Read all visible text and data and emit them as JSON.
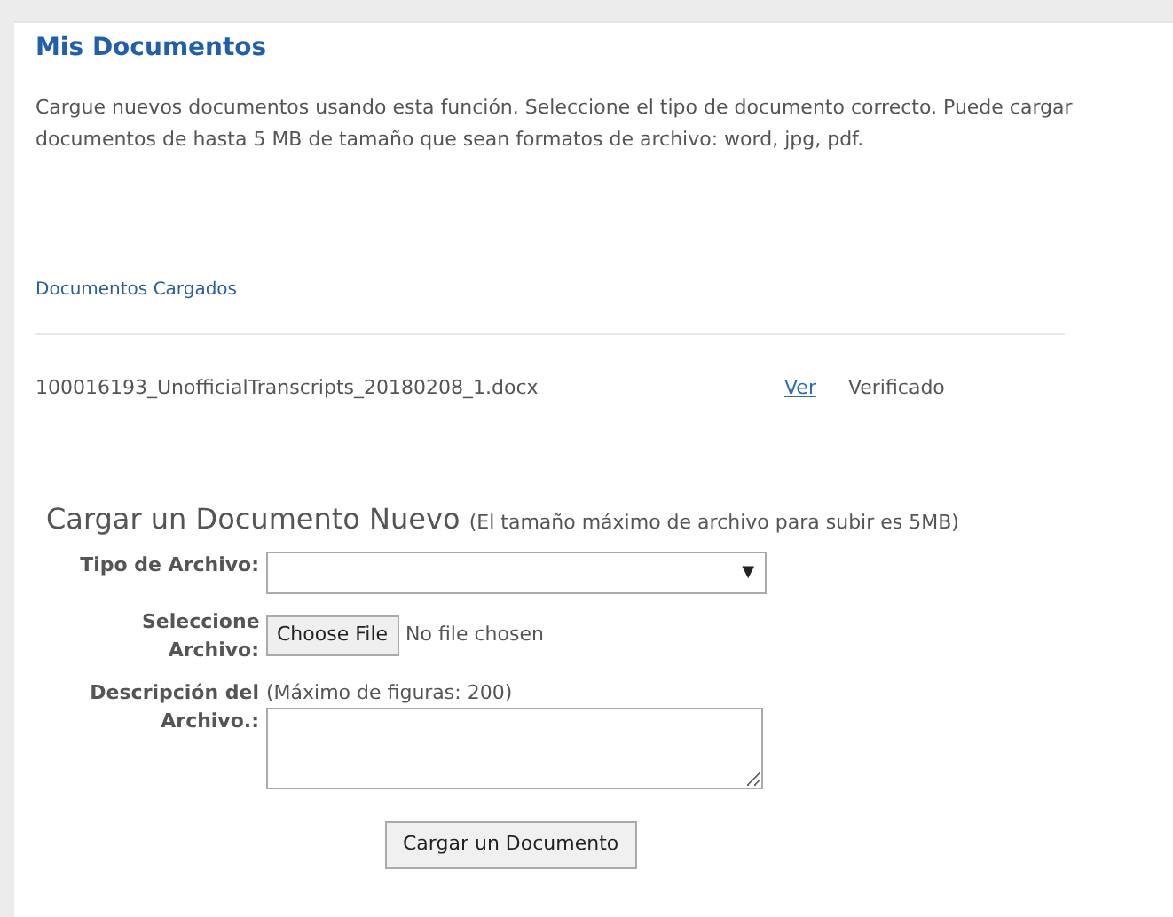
{
  "title": "Mis Documentos",
  "intro": "Cargue nuevos documentos usando esta función. Seleccione el tipo de documento correcto. Puede cargar documentos de hasta 5 MB de tamaño que sean formatos de archivo: word, jpg, pdf.",
  "uploaded_heading": "Documentos Cargados",
  "documents": [
    {
      "file_name": "100016193_UnofficialTranscripts_20180208_1.docx",
      "link": "Ver",
      "status": "Verificado"
    }
  ],
  "upload_form": {
    "heading": "Cargar un Documento Nuevo",
    "heading_note": "(El tamaño máximo de archivo para subir es 5MB)",
    "file_type": {
      "label": "Tipo de Archivo:",
      "arrow": "▼"
    },
    "file_select": {
      "label": "Seleccione Archivo:",
      "button": "Choose File",
      "status": "No file chosen"
    },
    "description": {
      "label": "Descripción del Archivo.:",
      "hint": "(Máximo de figuras: 200)"
    },
    "submit": "Cargar un Documento"
  }
}
